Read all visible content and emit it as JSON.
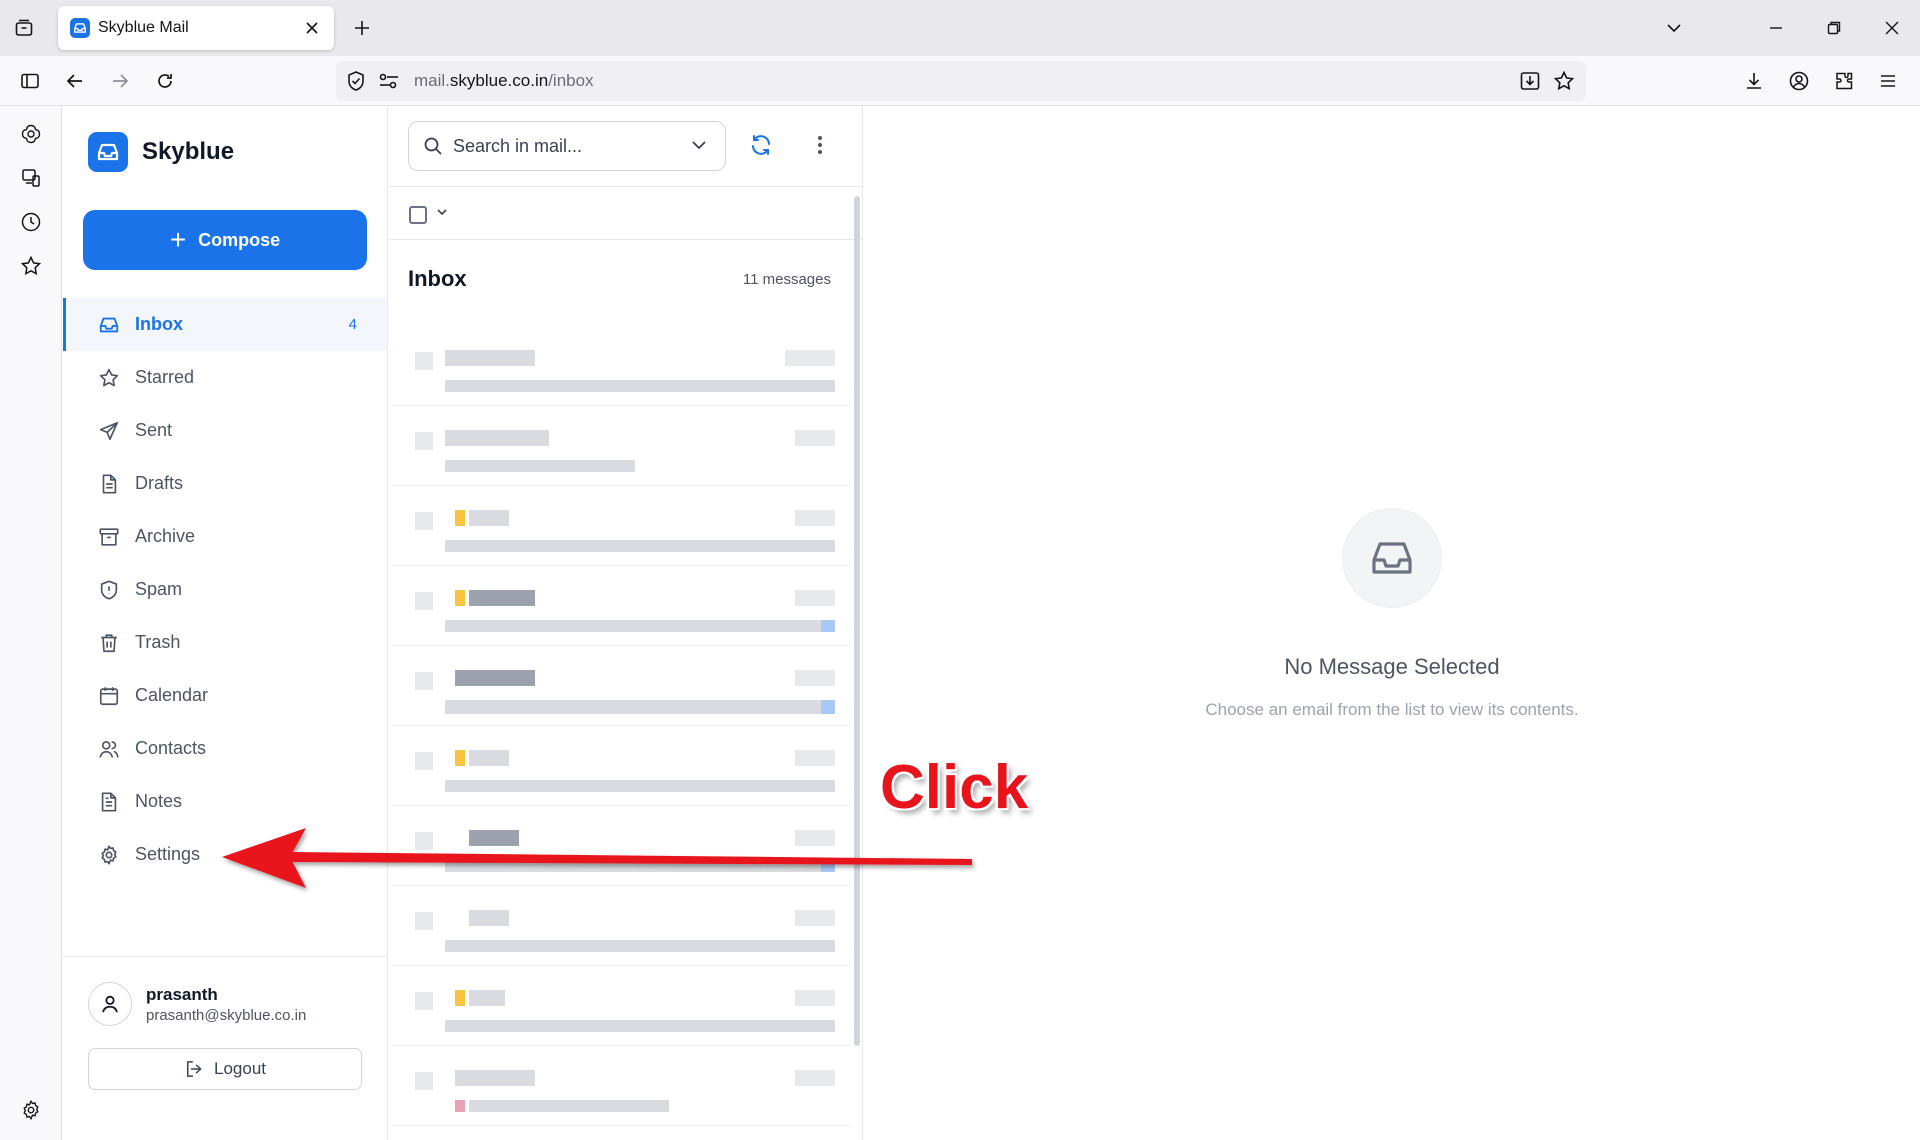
{
  "browser": {
    "tab_title": "Skyblue Mail",
    "url_prefix": "mail.",
    "url_domain": "skyblue.co.in",
    "url_path": "/inbox"
  },
  "app": {
    "brand": "Skyblue",
    "compose_label": "Compose",
    "nav": [
      {
        "label": "Inbox",
        "icon": "inbox-icon",
        "count": "4",
        "active": true
      },
      {
        "label": "Starred",
        "icon": "star-icon"
      },
      {
        "label": "Sent",
        "icon": "send-icon"
      },
      {
        "label": "Drafts",
        "icon": "draft-icon"
      },
      {
        "label": "Archive",
        "icon": "archive-icon"
      },
      {
        "label": "Spam",
        "icon": "shield-icon"
      },
      {
        "label": "Trash",
        "icon": "trash-icon"
      },
      {
        "label": "Calendar",
        "icon": "calendar-icon"
      },
      {
        "label": "Contacts",
        "icon": "contacts-icon"
      },
      {
        "label": "Notes",
        "icon": "notes-icon"
      },
      {
        "label": "Settings",
        "icon": "gear-icon"
      }
    ],
    "user": {
      "name": "prasanth",
      "email": "prasanth@skyblue.co.in"
    },
    "logout_label": "Logout"
  },
  "list": {
    "search_placeholder": "Search in mail...",
    "title": "Inbox",
    "count": "11 messages"
  },
  "reader": {
    "empty_title": "No Message Selected",
    "empty_subtitle": "Choose an email from the list to view its contents."
  },
  "annotation": {
    "label": "Click",
    "color": "#e8141c"
  },
  "colors": {
    "accent": "#1a73e8"
  }
}
